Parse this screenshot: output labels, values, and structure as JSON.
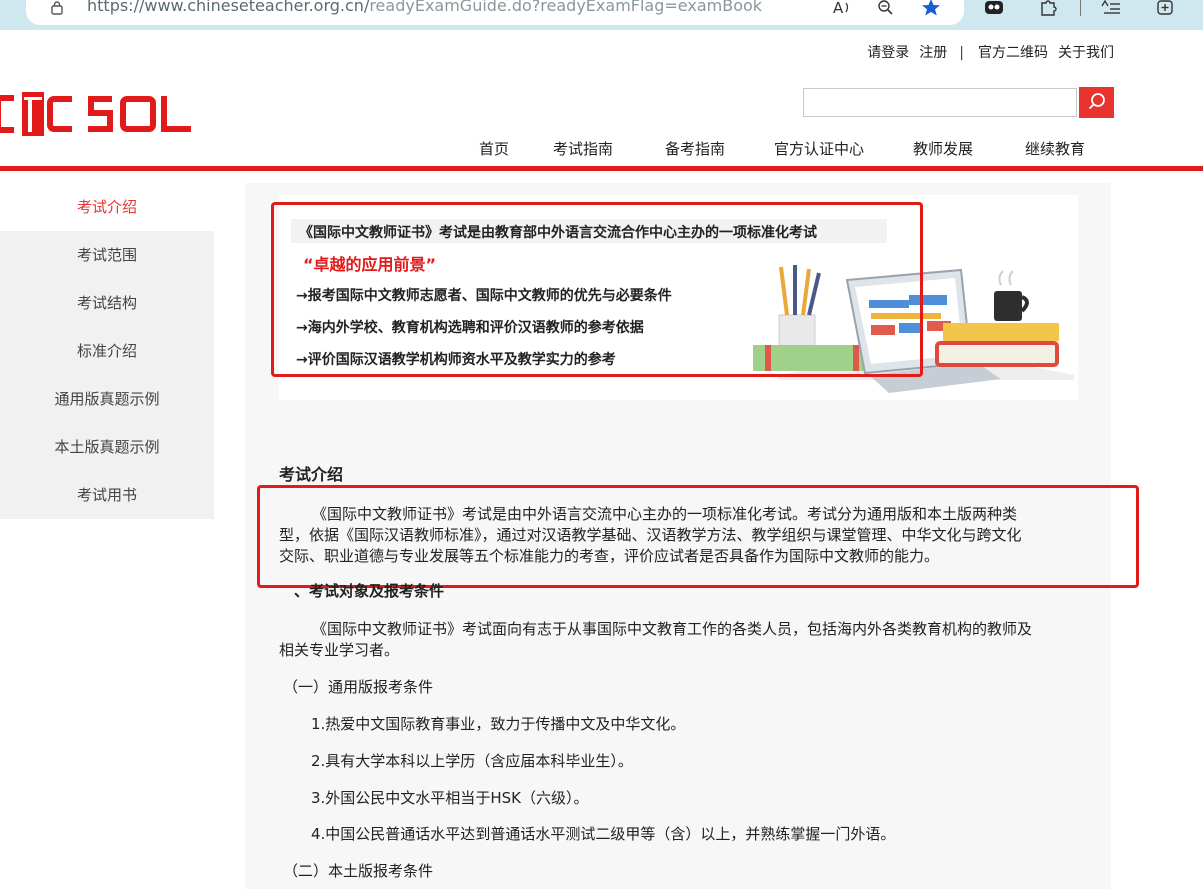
{
  "browser": {
    "url_main": "https://www.chineseteacher.org.cn/",
    "url_rest": "readyExamGuide.do?readyExamFlag=examBook"
  },
  "toplinks": {
    "login": "请登录",
    "register": "注册",
    "sep": "|",
    "qrcode": "官方二维码",
    "about": "关于我们"
  },
  "search": {
    "placeholder": ""
  },
  "nav": [
    "首页",
    "考试指南",
    "备考指南",
    "官方认证中心",
    "教师发展",
    "继续教育"
  ],
  "sidebar": [
    "考试介绍",
    "考试范围",
    "考试结构",
    "标准介绍",
    "通用版真题示例",
    "本土版真题示例",
    "考试用书"
  ],
  "banner": {
    "title": "《国际中文教师证书》考试是由教育部中外语言交流合作中心主办的一项标准化考试",
    "tagline": "“卓越的应用前景”",
    "points": [
      "→报考国际中文教师志愿者、国际中文教师的优先与必要条件",
      "→海内外学校、教育机构选聘和评价汉语教师的参考依据",
      "→评价国际汉语教学机构师资水平及教学实力的参考"
    ]
  },
  "content": {
    "heading": "考试介绍",
    "intro_lines": [
      "《国际中文教师证书》考试是由中外语言交流中心主办的一项标准化考试。考试分为通用版和本土版两种类",
      "型，依据《国际汉语教师标准》，通过对汉语教学基础、汉语教学方法、教学组织与课堂管理、中华文化与跨文化",
      "交际、职业道德与专业发展等五个标准能力的考查，评价应试者是否具备作为国际中文教师的能力。"
    ],
    "section1": "、考试对象及报考条件",
    "target_lines": [
      "《国际中文教师证书》考试面向有志于从事国际中文教育工作的各类人员，包括海内外各类教育机构的教师及",
      "相关专业学习者。"
    ],
    "general_heading": "（一）通用版报考条件",
    "general_items": [
      "1.热爱中文国际教育事业，致力于传播中文及中华文化。",
      "2.具有大学本科以上学历（含应届本科毕业生）。",
      "3.外国公民中文水平相当于HSK（六级）。",
      "4.中国公民普通话水平达到普通话水平测试二级甲等（含）以上，并熟练掌握一门外语。"
    ],
    "local_heading": "（二）本土版报考条件"
  }
}
